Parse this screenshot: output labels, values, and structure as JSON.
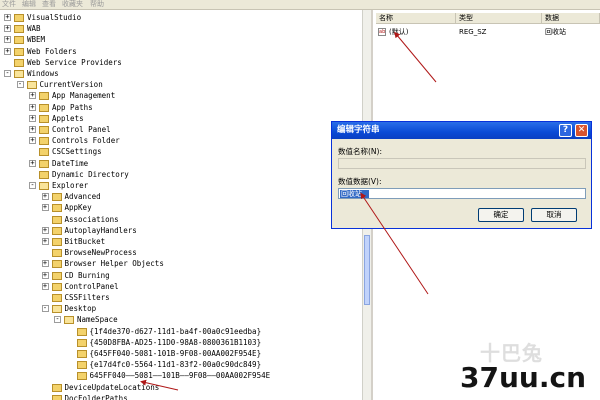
{
  "menubar": {
    "items": [
      "文件",
      "编辑",
      "查看",
      "收藏夹",
      "帮助"
    ]
  },
  "tree": [
    {
      "label": "VisualStudio",
      "level": 0,
      "exp": "+"
    },
    {
      "label": "WAB",
      "level": 0,
      "exp": "+"
    },
    {
      "label": "WBEM",
      "level": 0,
      "exp": "+"
    },
    {
      "label": "Web Folders",
      "level": 0,
      "exp": "+"
    },
    {
      "label": "Web Service Providers",
      "level": 0,
      "exp": ""
    },
    {
      "label": "Windows",
      "level": 0,
      "exp": "-",
      "open": true
    },
    {
      "label": "CurrentVersion",
      "level": 1,
      "exp": "-",
      "open": true
    },
    {
      "label": "App Management",
      "level": 2,
      "exp": "+"
    },
    {
      "label": "App Paths",
      "level": 2,
      "exp": "+"
    },
    {
      "label": "Applets",
      "level": 2,
      "exp": "+"
    },
    {
      "label": "Control Panel",
      "level": 2,
      "exp": "+"
    },
    {
      "label": "Controls Folder",
      "level": 2,
      "exp": "+"
    },
    {
      "label": "CSCSettings",
      "level": 2,
      "exp": ""
    },
    {
      "label": "DateTime",
      "level": 2,
      "exp": "+"
    },
    {
      "label": "Dynamic Directory",
      "level": 2,
      "exp": ""
    },
    {
      "label": "Explorer",
      "level": 2,
      "exp": "-",
      "open": true
    },
    {
      "label": "Advanced",
      "level": 3,
      "exp": "+"
    },
    {
      "label": "AppKey",
      "level": 3,
      "exp": "+"
    },
    {
      "label": "Associations",
      "level": 3,
      "exp": ""
    },
    {
      "label": "AutoplayHandlers",
      "level": 3,
      "exp": "+"
    },
    {
      "label": "BitBucket",
      "level": 3,
      "exp": "+"
    },
    {
      "label": "BrowseNewProcess",
      "level": 3,
      "exp": ""
    },
    {
      "label": "Browser Helper Objects",
      "level": 3,
      "exp": "+"
    },
    {
      "label": "CD Burning",
      "level": 3,
      "exp": "+"
    },
    {
      "label": "ControlPanel",
      "level": 3,
      "exp": "+"
    },
    {
      "label": "CSSFilters",
      "level": 3,
      "exp": ""
    },
    {
      "label": "Desktop",
      "level": 3,
      "exp": "-",
      "open": true
    },
    {
      "label": "NameSpace",
      "level": 4,
      "exp": "-",
      "open": true
    },
    {
      "label": "{1f4de370-d627-11d1-ba4f-00a0c91eedba}",
      "level": 5,
      "exp": ""
    },
    {
      "label": "{450D8FBA-AD25-11D0-98A8-0800361B1103}",
      "level": 5,
      "exp": ""
    },
    {
      "label": "{645FF040-5081-101B-9F08-00AA002F954E}",
      "level": 5,
      "exp": ""
    },
    {
      "label": "{e17d4fc0-5564-11d1-83f2-00a0c90dc849}",
      "level": 5,
      "exp": ""
    },
    {
      "label": "645FF040——5081——101B——9F08——00AA002F954E",
      "level": 5,
      "exp": ""
    },
    {
      "label": "DeviceUpdateLocations",
      "level": 3,
      "exp": ""
    },
    {
      "label": "DocFolderPaths",
      "level": 3,
      "exp": ""
    }
  ],
  "list": {
    "headers": [
      "名称",
      "类型",
      "数据"
    ],
    "rows": [
      {
        "name": "(默认)",
        "type": "REG_SZ",
        "data": "回收站"
      }
    ]
  },
  "dialog": {
    "title": "编辑字符串",
    "help_glyph": "?",
    "close_glyph": "✕",
    "name_label": "数值名称(N):",
    "data_label": "数值数据(V):",
    "data_value": "回收站",
    "ok_label": "确定",
    "cancel_label": "取消"
  },
  "watermark": {
    "logo_text": "十巴兔",
    "site_text": "37uu.cn"
  },
  "colors": {
    "title_bar": "#0a4ad6",
    "folder": "#f3d26b",
    "arrow": "#b01818"
  }
}
